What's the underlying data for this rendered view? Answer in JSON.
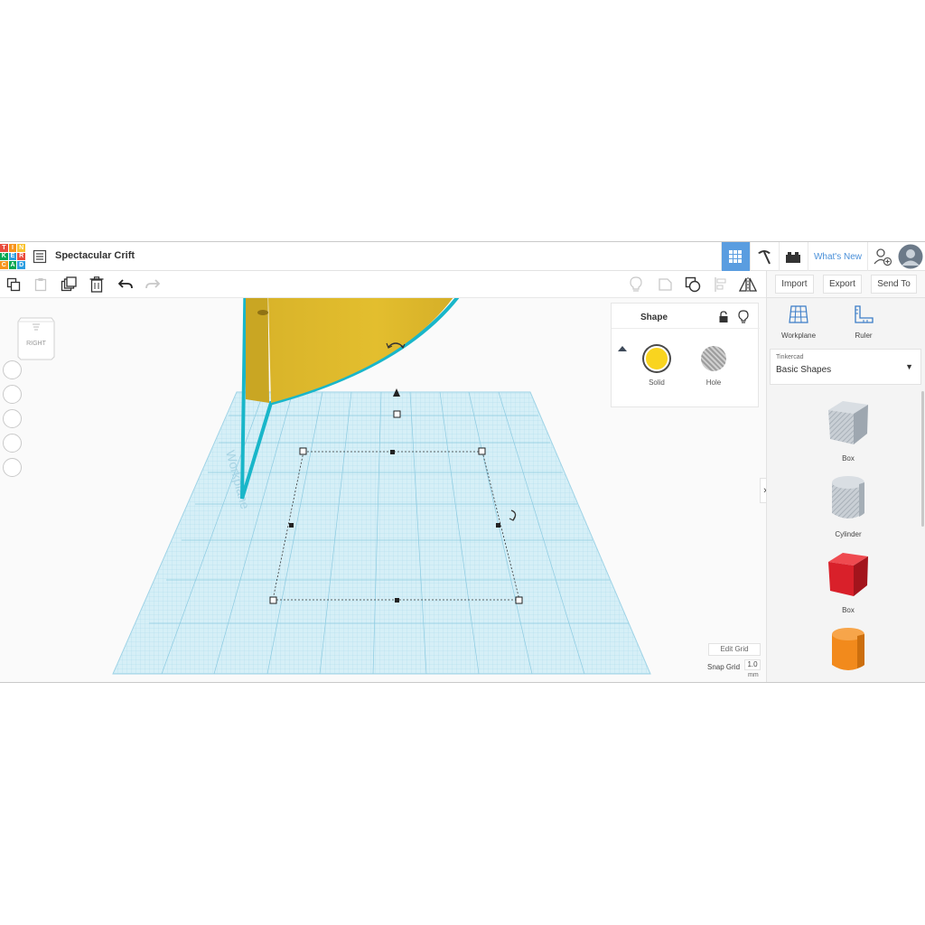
{
  "logo": {
    "letters": [
      "T",
      "I",
      "N",
      "K",
      "E",
      "R",
      "C",
      "A",
      "D"
    ],
    "colors": [
      "#e94c3d",
      "#f7941d",
      "#f9c22e",
      "#00a651",
      "#2d9ee0",
      "#e94c3d",
      "#f7941d",
      "#00a651",
      "#2d9ee0"
    ]
  },
  "header": {
    "title": "Spectacular Crift",
    "whats_new": "What's New",
    "icons": [
      "grid-view-icon",
      "pickaxe-icon",
      "brick-icon",
      "add-user-icon",
      "avatar"
    ]
  },
  "toolbar": {
    "buttons": [
      "copy-icon",
      "paste-icon",
      "duplicate-icon",
      "delete-icon",
      "undo-icon",
      "redo-icon",
      "light-bulb-icon",
      "group-icon",
      "ungroup-icon",
      "align-icon",
      "mirror-icon"
    ],
    "import": "Import",
    "export": "Export",
    "send_to": "Send To"
  },
  "viewport": {
    "view_cube_label": "RIGHT",
    "workplane_label": "Workplane",
    "edit_grid": "Edit Grid",
    "snap_grid_label": "Snap Grid",
    "snap_grid_value": "1.0",
    "snap_grid_unit": "mm"
  },
  "inspector": {
    "title": "Shape",
    "solid_label": "Solid",
    "hole_label": "Hole",
    "solid_color": "#f9d41f",
    "selection_color": "#19b6c9"
  },
  "panel": {
    "workplane": "Workplane",
    "ruler": "Ruler",
    "library_source": "Tinkercad",
    "library_name": "Basic Shapes",
    "shapes": [
      {
        "label": "Box",
        "color": "#b8c0c8"
      },
      {
        "label": "Cylinder",
        "color": "#c0c6cc"
      },
      {
        "label": "Box",
        "color": "#d9202a"
      },
      {
        "label": "",
        "color": "#f28a1c"
      }
    ]
  }
}
